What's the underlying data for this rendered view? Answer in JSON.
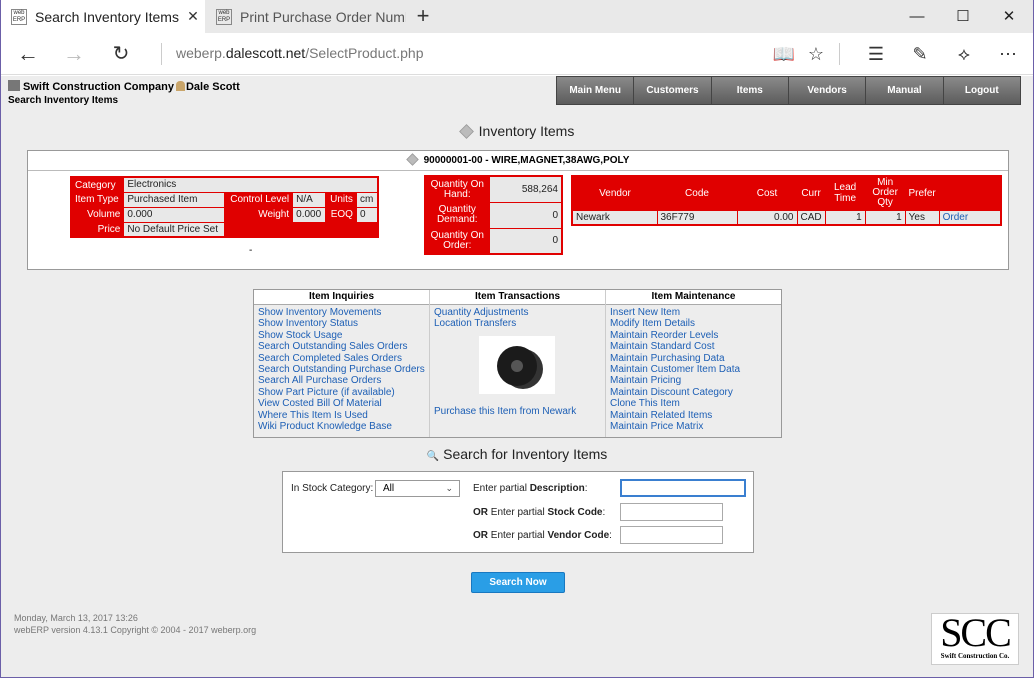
{
  "browser": {
    "tabs": [
      {
        "title": "Search Inventory Items",
        "favicon": "web ERP"
      },
      {
        "title": "Print Purchase Order Numb",
        "favicon": "web ERP"
      }
    ],
    "url_prefix": "weberp.",
    "url_host": "dalescott.net",
    "url_path": "/SelectProduct.php",
    "icons": [
      "back-icon",
      "forward-icon",
      "refresh-icon",
      "reading-view-icon",
      "favorite-star-icon",
      "hub-icon",
      "web-note-icon",
      "share-icon",
      "more-icon"
    ]
  },
  "header": {
    "company": "Swift Construction Company",
    "user": "Dale Scott",
    "page_title": "Search Inventory Items",
    "menu": [
      "Main Menu",
      "Customers",
      "Items",
      "Vendors",
      "Manual",
      "Logout"
    ]
  },
  "inventory": {
    "title": "Inventory Items",
    "item_heading": "90000001-00 - WIRE,MAGNET,38AWG,POLY",
    "details": {
      "category_label": "Category",
      "category": "Electronics",
      "item_type_label": "Item Type",
      "item_type": "Purchased Item",
      "control_level_label": "Control Level",
      "control_level": "N/A",
      "units_label": "Units",
      "units": "cm",
      "volume_label": "Volume",
      "volume": "0.000",
      "weight_label": "Weight",
      "weight": "0.000",
      "eoq_label": "EOQ",
      "eoq": "0",
      "price_label": "Price",
      "price": "No Default Price Set"
    },
    "dash": "-",
    "quantities": [
      {
        "label": "Quantity On Hand:",
        "value": "588,264"
      },
      {
        "label": "Quantity Demand:",
        "value": "0"
      },
      {
        "label": "Quantity On Order:",
        "value": "0"
      }
    ],
    "vendor_headers": [
      "Vendor",
      "Code",
      "Cost",
      "Curr",
      "Lead Time",
      "Min Order Qty",
      "Prefer",
      ""
    ],
    "vendor_row": {
      "vendor": "Newark",
      "code": "36F779",
      "cost": "0.00",
      "curr": "CAD",
      "lead": "1",
      "min_qty": "1",
      "prefer": "Yes",
      "order": "Order"
    }
  },
  "link_sections": {
    "inquiries": {
      "title": "Item Inquiries",
      "items": [
        "Show Inventory Movements",
        "Show Inventory Status",
        "Show Stock Usage",
        "Search Outstanding Sales Orders",
        "Search Completed Sales Orders",
        "Search Outstanding Purchase Orders",
        "Search All Purchase Orders",
        "Show Part Picture (if available)",
        "View Costed Bill Of Material",
        "Where This Item Is Used",
        "Wiki Product Knowledge Base"
      ]
    },
    "transactions": {
      "title": "Item Transactions",
      "items": [
        "Quantity Adjustments",
        "Location Transfers"
      ],
      "purchase_link": "Purchase this Item from Newark"
    },
    "maintenance": {
      "title": "Item Maintenance",
      "items": [
        "Insert New Item",
        "Modify Item Details",
        "Maintain Reorder Levels",
        "Maintain Standard Cost",
        "Maintain Purchasing Data",
        "Maintain Customer Item Data",
        "Maintain Pricing",
        "Maintain Discount Category",
        "Clone This Item",
        "Maintain Related Items",
        "Maintain Price Matrix"
      ]
    }
  },
  "search": {
    "title": "Search for Inventory Items",
    "category_label": "In Stock Category:",
    "category_value": "All",
    "desc_label_pre": "Enter partial ",
    "desc_label_bold": "Description",
    "desc_label_post": ":",
    "code_label_or": "OR",
    "code_label_mid": " Enter partial ",
    "code_label_bold": "Stock Code",
    "code_label_post": ":",
    "vendor_label_bold": "Vendor Code",
    "button": "Search Now"
  },
  "footer": {
    "datetime": "Monday, March 13, 2017 13:26",
    "version": "webERP version 4.13.1 Copyright © 2004 - 2017 ",
    "link": "weberp.org"
  },
  "logo": {
    "mark": "SCC",
    "text": "Swift Construction Co."
  }
}
